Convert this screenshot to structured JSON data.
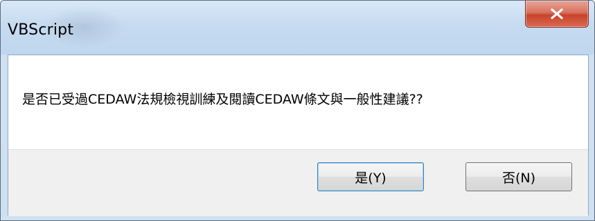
{
  "window": {
    "title": "VBScript",
    "close_icon": "close-icon"
  },
  "message": {
    "text": "是否已受過CEDAW法規檢視訓練及閱讀CEDAW條文與一般性建議??"
  },
  "buttons": {
    "yes_label": "是(Y)",
    "no_label": "否(N)"
  },
  "colors": {
    "titlebar": "#c6dbf0",
    "close_button": "#c8432a",
    "footer": "#f0f0f0",
    "default_button_border": "#3c7fb1"
  }
}
